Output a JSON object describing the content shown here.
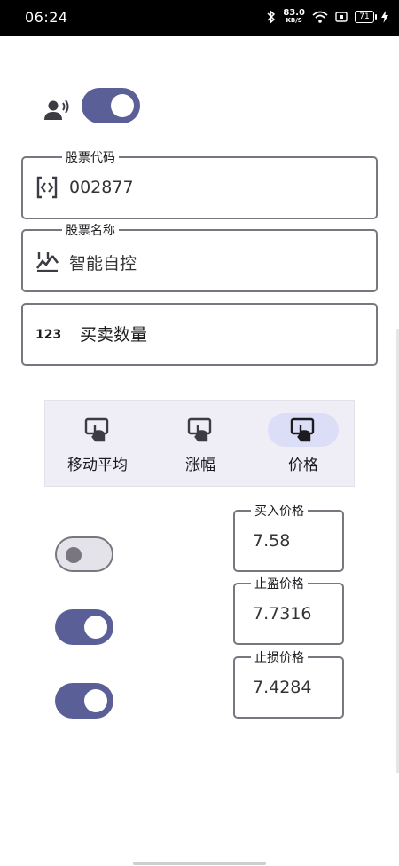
{
  "status_bar": {
    "time": "06:24",
    "net_speed_value": "83.0",
    "net_speed_unit": "KB/S",
    "battery": "71"
  },
  "voice_switch": {
    "on": true
  },
  "stock_code": {
    "label": "股票代码",
    "value": "002877"
  },
  "stock_name": {
    "label": "股票名称",
    "value": "智能自控"
  },
  "quantity": {
    "icon_text": "123",
    "placeholder": "买卖数量"
  },
  "mode_tabs": {
    "items": [
      {
        "label": "移动平均",
        "selected": false
      },
      {
        "label": "涨幅",
        "selected": false
      },
      {
        "label": "价格",
        "selected": true
      }
    ]
  },
  "price_switches": [
    {
      "on": false
    },
    {
      "on": true
    },
    {
      "on": true
    }
  ],
  "prices": {
    "buy": {
      "label": "买入价格",
      "value": "7.58"
    },
    "take_profit": {
      "label": "止盈价格",
      "value": "7.7316"
    },
    "stop_loss": {
      "label": "止损价格",
      "value": "7.4284"
    }
  },
  "colors": {
    "accent": "#5a5f98",
    "selected_pill": "#dcdef7",
    "outline": "#79767f"
  }
}
